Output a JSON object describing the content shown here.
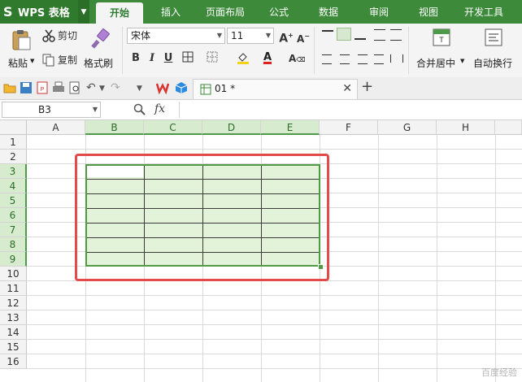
{
  "app": {
    "logo_label": "WPS 表格"
  },
  "menu_tabs": [
    "开始",
    "插入",
    "页面布局",
    "公式",
    "数据",
    "审阅",
    "视图",
    "开发工具"
  ],
  "ribbon": {
    "paste": "粘贴",
    "cut": "剪切",
    "copy": "复制",
    "format_painter": "格式刷",
    "font_name": "宋体",
    "font_size": "11",
    "merge_center": "合并居中",
    "wrap_text": "自动换行"
  },
  "document_tab": {
    "name": "01 *"
  },
  "formula_bar": {
    "cell_ref": "B3",
    "fx": "fx"
  },
  "sheet": {
    "columns": [
      "A",
      "B",
      "C",
      "D",
      "E",
      "F",
      "G",
      "H"
    ],
    "rows": [
      "1",
      "2",
      "3",
      "4",
      "5",
      "6",
      "7",
      "8",
      "9",
      "10",
      "11",
      "12",
      "13",
      "14",
      "15",
      "16"
    ],
    "selected_range": "B3:E9",
    "active_cell": "B3"
  },
  "colors": {
    "brand_green": "#3c8a3a",
    "selection_fill": "#e3f3d9",
    "selection_border": "#4f9a43",
    "annotation_red": "#e34b4b"
  }
}
